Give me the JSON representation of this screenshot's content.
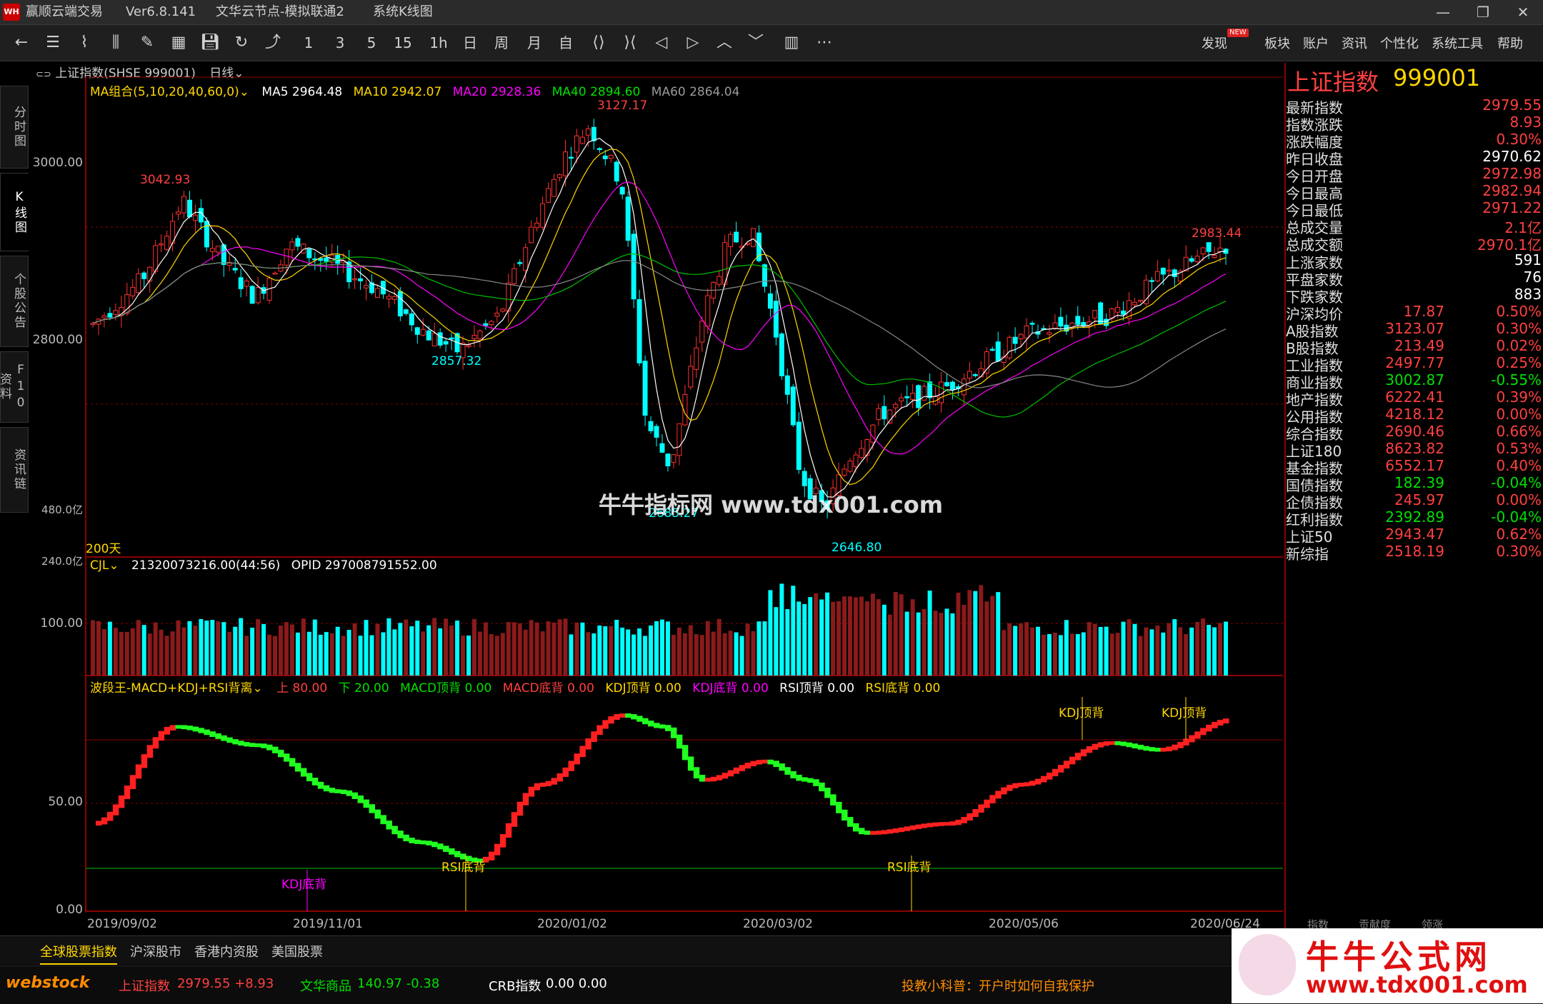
{
  "titlebar": {
    "logo": "WH",
    "app": "赢顺云端交易",
    "version": "Ver6.8.141",
    "node": "文华云节点-模拟联通2",
    "window": "系统K线图"
  },
  "toolbar": {
    "periods": [
      "1",
      "3",
      "5",
      "15",
      "1h",
      "日",
      "周",
      "月",
      "自"
    ],
    "menus": [
      "发现",
      "板块",
      "账户",
      "资讯",
      "个性化",
      "系统工具",
      "帮助"
    ],
    "new_badge": "NEW"
  },
  "sidetabs": [
    "分时图",
    "K线图",
    "个股公告",
    "F10资料",
    "资讯链"
  ],
  "chart": {
    "symbol_line": "上证指数(SHSE 999001)",
    "period": "日线",
    "ma_label": "MA组合(5,10,20,40,60,0)",
    "ma5": "MA5 2964.48",
    "ma10": "MA10 2942.07",
    "ma20": "MA20 2928.36",
    "ma40": "MA40 2894.60",
    "ma60": "MA60 2864.04",
    "days": "200天",
    "price_axis": [
      "3000.00",
      "2800.00"
    ],
    "price_marks": [
      "3042.93",
      "3127.17",
      "2857.32",
      "2685.27",
      "2646.80",
      "2983.44"
    ],
    "vol_axis": [
      "480.0亿",
      "240.0亿"
    ],
    "vol_label": "CJL",
    "vol_value": "21320073216.00(44:56)",
    "opid": "OPID 297008791552.00",
    "ind_title": "波段王-MACD+KDJ+RSI背离",
    "ind_up": "上 80.00",
    "ind_down": "下 20.00",
    "ind_items": [
      {
        "t": "MACD顶背 0.00",
        "c": "#00e000"
      },
      {
        "t": "MACD底背 0.00",
        "c": "#ff4040"
      },
      {
        "t": "KDJ顶背 0.00",
        "c": "#ffd700"
      },
      {
        "t": "KDJ底背 0.00",
        "c": "#ff00ff"
      },
      {
        "t": "RSI顶背 0.00",
        "c": "#ffffff"
      },
      {
        "t": "RSI底背 0.00",
        "c": "#ffd700"
      }
    ],
    "ind_axis": [
      "100.00",
      "50.00",
      "0.00"
    ],
    "ind_marks": [
      "KDJ顶背",
      "KDJ顶背",
      "KDJ底背",
      "RSI底背",
      "RSI底背"
    ],
    "dates": [
      "2019/09/02",
      "2019/11/01",
      "2020/01/02",
      "2020/03/02",
      "2020/05/06",
      "2020/06/24"
    ],
    "watermark": "牛牛指标网 www.tdx001.com"
  },
  "quote": {
    "name": "上证指数",
    "code": "999001",
    "rows": [
      {
        "label": "最新指数",
        "v2": "2979.55",
        "c2": "red"
      },
      {
        "label": "指数涨跌",
        "v2": "8.93",
        "c2": "red"
      },
      {
        "label": "涨跌幅度",
        "v2": "0.30%",
        "c2": "red"
      },
      {
        "label": "昨日收盘",
        "v2": "2970.62",
        "c2": "white"
      },
      {
        "label": "今日开盘",
        "v2": "2972.98",
        "c2": "red"
      },
      {
        "label": "今日最高",
        "v2": "2982.94",
        "c2": "red"
      },
      {
        "label": "今日最低",
        "v2": "2971.22",
        "c2": "red"
      },
      {
        "label": "总成交量",
        "v2": "2.1亿",
        "c2": "red"
      },
      {
        "label": "总成交额",
        "v2": "2970.1亿",
        "c2": "red"
      },
      {
        "label": "上涨家数",
        "v2": "591",
        "c2": "white"
      },
      {
        "label": "平盘家数",
        "v2": "76",
        "c2": "white"
      },
      {
        "label": "下跌家数",
        "v2": "883",
        "c2": "white"
      },
      {
        "label": "沪深均价",
        "v1": "17.87",
        "c1": "red",
        "v2": "0.50%",
        "c2": "red"
      },
      {
        "label": "A股指数",
        "v1": "3123.07",
        "c1": "red",
        "v2": "0.30%",
        "c2": "red"
      },
      {
        "label": "B股指数",
        "v1": "213.49",
        "c1": "red",
        "v2": "0.02%",
        "c2": "red"
      },
      {
        "label": "工业指数",
        "v1": "2497.77",
        "c1": "red",
        "v2": "0.25%",
        "c2": "red"
      },
      {
        "label": "商业指数",
        "v1": "3002.87",
        "c1": "green",
        "v2": "-0.55%",
        "c2": "green"
      },
      {
        "label": "地产指数",
        "v1": "6222.41",
        "c1": "red",
        "v2": "0.39%",
        "c2": "red"
      },
      {
        "label": "公用指数",
        "v1": "4218.12",
        "c1": "red",
        "v2": "0.00%",
        "c2": "red"
      },
      {
        "label": "综合指数",
        "v1": "2690.46",
        "c1": "red",
        "v2": "0.66%",
        "c2": "red"
      },
      {
        "label": "上证180",
        "v1": "8623.82",
        "c1": "red",
        "v2": "0.53%",
        "c2": "red"
      },
      {
        "label": "基金指数",
        "v1": "6552.17",
        "c1": "red",
        "v2": "0.40%",
        "c2": "red"
      },
      {
        "label": "国债指数",
        "v1": "182.39",
        "c1": "green",
        "v2": "-0.04%",
        "c2": "green"
      },
      {
        "label": "企债指数",
        "v1": "245.97",
        "c1": "red",
        "v2": "0.00%",
        "c2": "red"
      },
      {
        "label": "红利指数",
        "v1": "2392.89",
        "c1": "green",
        "v2": "-0.04%",
        "c2": "green"
      },
      {
        "label": "上证50",
        "v1": "2943.47",
        "c1": "red",
        "v2": "0.62%",
        "c2": "red"
      },
      {
        "label": "新综指",
        "v1": "2518.19",
        "c1": "red",
        "v2": "0.30%",
        "c2": "red"
      }
    ],
    "bottom_tabs": [
      "指数",
      "贡献度",
      "领涨"
    ]
  },
  "btabs": [
    "全球股票指数",
    "沪深股市",
    "香港内资股",
    "美国股票"
  ],
  "status": {
    "brand": "webstock",
    "idx1_name": "上证指数",
    "idx1_val": "2979.55  +8.93",
    "idx2_name": "文华商品",
    "idx2_val": "140.97  -0.38",
    "idx3_name": "CRB指数",
    "idx3_val": "0.00  0.00",
    "tip": "投教小科普：开户时如何自我保护"
  },
  "logo_wm": {
    "cn": "牛牛公式网",
    "url": "www.tdx001.com"
  },
  "colors": {
    "up": "#ff3030",
    "down": "#00ffff",
    "bg": "#000000",
    "grid": "#8b0000"
  }
}
